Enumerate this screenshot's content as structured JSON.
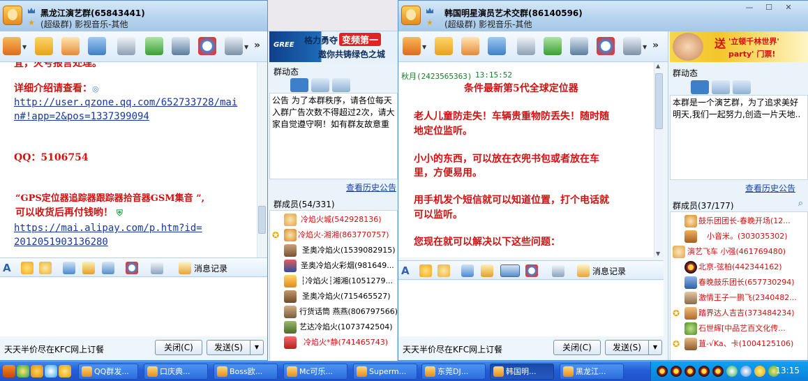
{
  "window1": {
    "title": "黑龙江演艺群(65843441)",
    "subtitle": "(超级群) 影视音乐-其他",
    "chat_lines": [
      {
        "text": "宜，灭号报言处理。",
        "type": "text"
      },
      {
        "text": "详细介绍请查看：",
        "type": "text"
      },
      {
        "text": "http://user.qzone.qq.com/652733728/mai",
        "type": "link"
      },
      {
        "text": "n#!app=2&pos=1337399094",
        "type": "link"
      },
      {
        "text": "QQ：5106754",
        "type": "text"
      },
      {
        "text": "“GPS定位器追踪器跟踪器拾音器GSM集音 ”,",
        "type": "text"
      },
      {
        "text": "可以收货后再付钱哟！",
        "type": "text"
      },
      {
        "text": "https://mai.alipay.com/p.htm?id=",
        "type": "link"
      },
      {
        "text": "2012051903136280",
        "type": "link"
      }
    ],
    "message_record": "消息记录",
    "ad_text": "天天半价尽在KFC网上订餐",
    "close_button": "关闭(C)",
    "send_button": "发送(S)",
    "banner_text1": "格力勇夺",
    "banner_highlight": "变频第一",
    "banner_text2": "遨你共铸绿色之城",
    "banner_brand": "GREE",
    "group_news_label": "群动态",
    "notice": "公告  为了本群秩序，请各位每天入群广告次数不得超过2次，请大家自觉遵守啊！如有群友故意重",
    "history_link": "查看历史公告",
    "members_label": "群成员(54/331)",
    "members": [
      {
        "name": "冷焰火城(542928136)",
        "color": "red"
      },
      {
        "name": "冷焰火-湘湘(863770757)",
        "color": "red"
      },
      {
        "name": "圣奥冷焰火(1539082915)",
        "color": "black"
      },
      {
        "name": "圣奥冷焰火彩烟(981649...",
        "color": "black"
      },
      {
        "name": "┆冷焰火┆湘湘(1051279...",
        "color": "black"
      },
      {
        "name": "圣奥冷焰火(715465527)",
        "color": "black"
      },
      {
        "name": "行货话筒 燕燕(806797566)",
        "color": "black"
      },
      {
        "name": "艺达冷焰火(1073742504)",
        "color": "black"
      },
      {
        "name": "冷焰火*静(741465743)",
        "color": "red"
      }
    ]
  },
  "window2": {
    "title": "韩国明星演员艺术交群(86140596)",
    "subtitle": "(超级群) 影视音乐-其他",
    "sender": "秋月(2423565363)",
    "time": "13:15:52",
    "chat_lines": [
      "条件最新第5代全球定位器",
      "老人儿童防走失！车辆贵重物防丢失！随时随",
      "地定位监听。",
      "小小的东西，可以放在衣兜书包或者放在车",
      "里，方便易用。",
      "用手机发个短信就可以知道位置，打个电话就",
      "可以监听。",
      "您现在就可以解决以下这些问题："
    ],
    "message_record": "消息记录",
    "ad_text": "天天半价尽在KFC网上订餐",
    "close_button": "关闭(C)",
    "send_button": "发送(S)",
    "banner_text": "送",
    "banner_text2": "'立顿千林世界'",
    "banner_text3": "party' 门票!",
    "group_news_label": "群动态",
    "notice": "本群是一个演艺群，为了追求美好明天,我们一起努力,创造一片天地..",
    "history_link": "查看历史公告",
    "members_label": "群成员(37/177)",
    "members": [
      {
        "name": "鼓乐团团长-春晚开场(12...",
        "color": "red"
      },
      {
        "name": "小音米。(303035302)",
        "color": "red"
      },
      {
        "name": "演艺飞车  小强(461769480)",
        "color": "red"
      },
      {
        "name": "北京-弦柏(442344162)",
        "color": "red"
      },
      {
        "name": "春晚鼓乐团长(657730294)",
        "color": "red"
      },
      {
        "name": "激情王子一鹏飞(2340482...",
        "color": "red"
      },
      {
        "name": "踏界达人吉吉(373484234)",
        "color": "red"
      },
      {
        "name": "石世辉[中品艺百文化传...",
        "color": "red"
      },
      {
        "name": "苴-√Ka、卡(1004125106)",
        "color": "red"
      }
    ]
  },
  "taskbar": {
    "buttons": [
      "QQ群发...",
      "口庆典...",
      "Boss欧...",
      "Mc可乐...",
      "Superm...",
      "东莞DJ...",
      "韩国明...",
      "黑龙江..."
    ],
    "clock": "13:15"
  },
  "colors": {
    "accent": "#d41010",
    "link": "#1836a8",
    "taskbar": "#245ed8"
  }
}
